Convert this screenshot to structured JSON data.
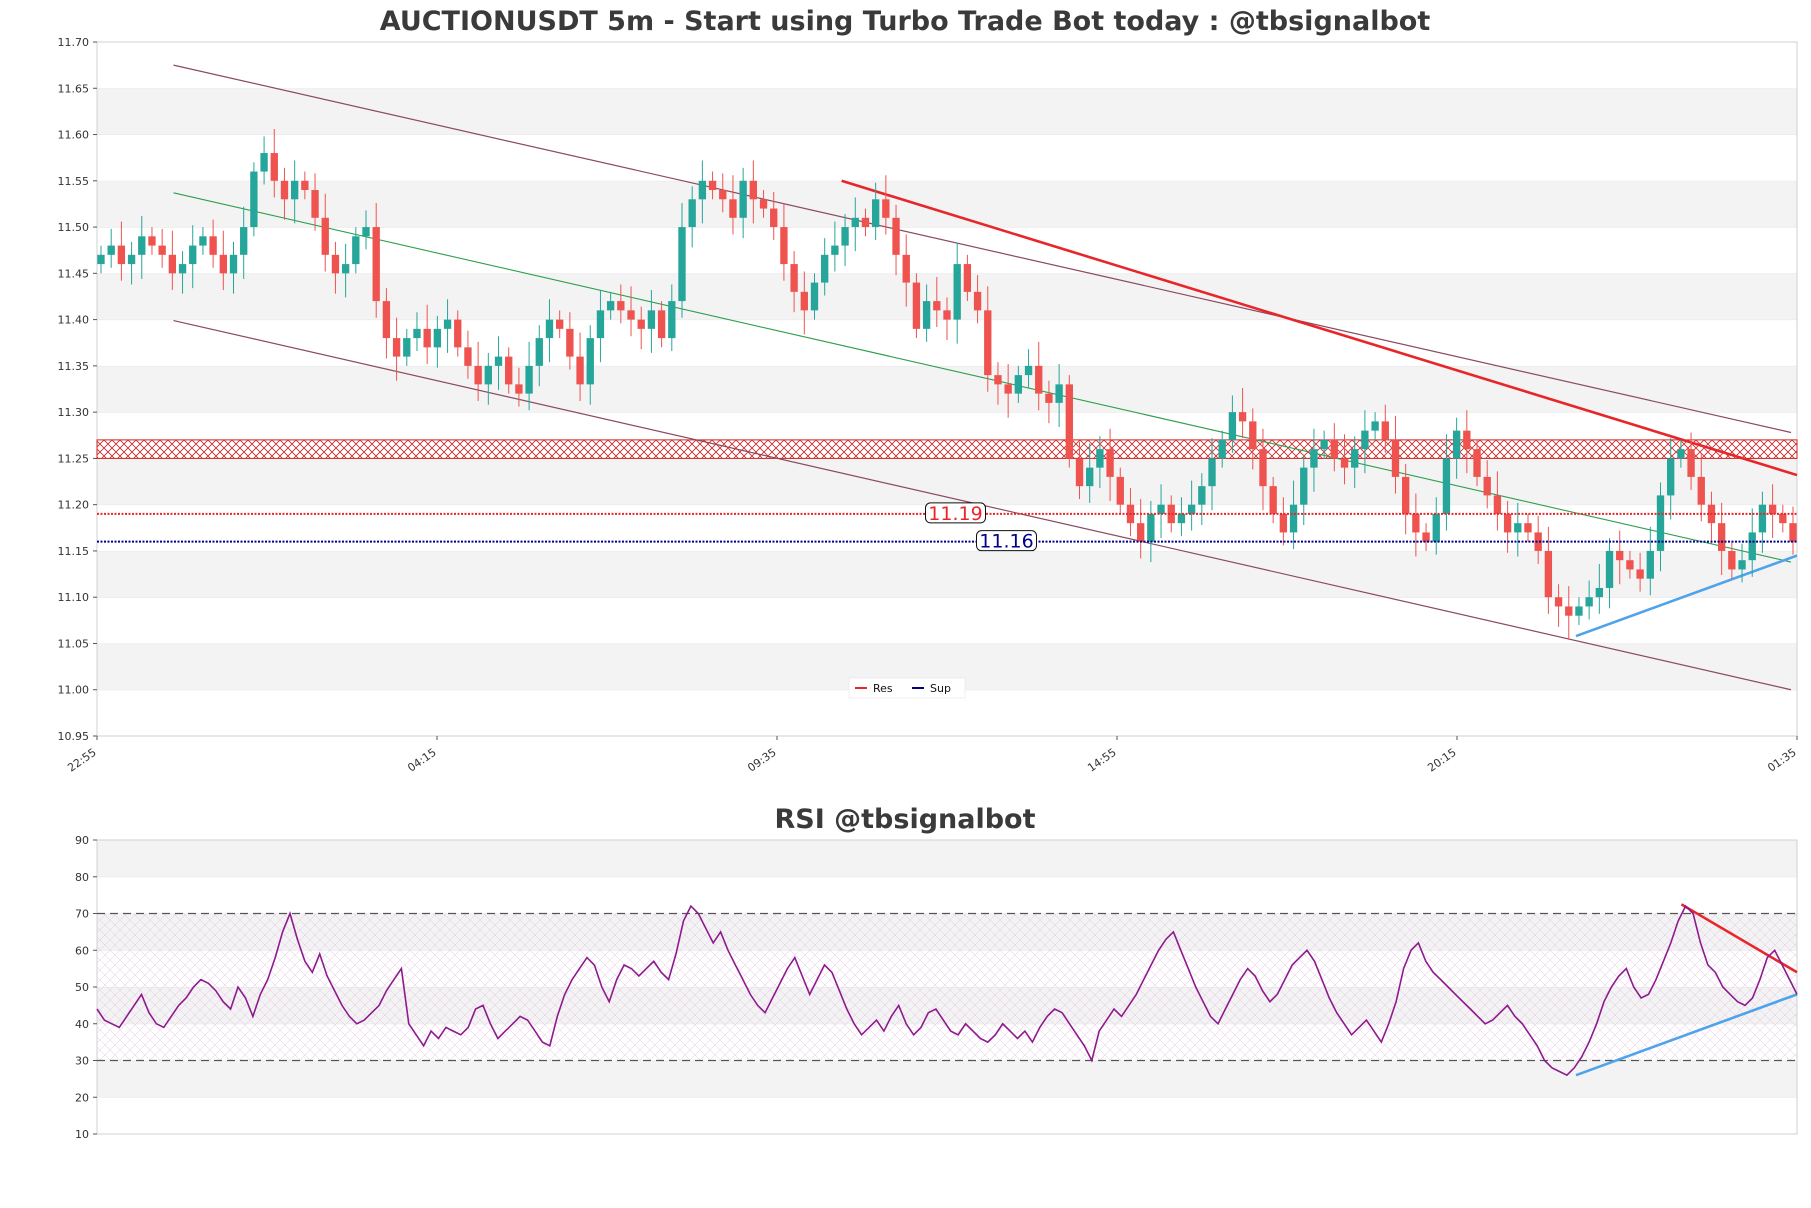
{
  "chart_data": [
    {
      "type": "candlestick",
      "title": "AUCTIONUSDT 5m - Start using Turbo Trade Bot today : @tbsignalbot",
      "ylim": [
        10.95,
        11.7
      ],
      "y_ticks": [
        "10.95",
        "11.00",
        "11.05",
        "11.10",
        "11.15",
        "11.20",
        "11.25",
        "11.30",
        "11.35",
        "11.40",
        "11.45",
        "11.50",
        "11.55",
        "11.60",
        "11.65",
        "11.70"
      ],
      "x_ticks": [
        "22:55",
        "04:15",
        "09:35",
        "14:55",
        "20:15",
        "01:35"
      ],
      "colors": {
        "up": "#26a69a",
        "down": "#ef5350",
        "resistance": "#e8262a",
        "support": "#00008b",
        "channel": "#8b4a5e",
        "midline": "#2e9e4e",
        "trend_up": "#4ea3ea",
        "zone": "#cc2222"
      },
      "legend": [
        {
          "label": "Res",
          "color": "#e8262a"
        },
        {
          "label": "Sup",
          "color": "#00008b"
        }
      ],
      "levels": [
        {
          "name": "Res",
          "value": 11.19,
          "label": "11.19"
        },
        {
          "name": "Sup",
          "value": 11.16,
          "label": "11.16"
        }
      ],
      "resistance_zone": [
        11.25,
        11.27
      ],
      "close_series": [
        11.47,
        11.48,
        11.46,
        11.47,
        11.49,
        11.48,
        11.47,
        11.45,
        11.46,
        11.48,
        11.49,
        11.47,
        11.45,
        11.47,
        11.5,
        11.56,
        11.58,
        11.55,
        11.53,
        11.55,
        11.54,
        11.51,
        11.47,
        11.45,
        11.46,
        11.49,
        11.5,
        11.42,
        11.38,
        11.36,
        11.38,
        11.39,
        11.37,
        11.39,
        11.4,
        11.37,
        11.35,
        11.33,
        11.35,
        11.36,
        11.33,
        11.32,
        11.35,
        11.38,
        11.4,
        11.39,
        11.36,
        11.33,
        11.38,
        11.41,
        11.42,
        11.41,
        11.4,
        11.39,
        11.41,
        11.38,
        11.42,
        11.5,
        11.53,
        11.55,
        11.54,
        11.53,
        11.51,
        11.55,
        11.53,
        11.52,
        11.5,
        11.46,
        11.43,
        11.41,
        11.44,
        11.47,
        11.48,
        11.5,
        11.51,
        11.5,
        11.53,
        11.51,
        11.47,
        11.44,
        11.39,
        11.42,
        11.41,
        11.4,
        11.46,
        11.43,
        11.41,
        11.34,
        11.33,
        11.32,
        11.34,
        11.35,
        11.32,
        11.31,
        11.33,
        11.25,
        11.22,
        11.24,
        11.26,
        11.23,
        11.2,
        11.18,
        11.16,
        11.19,
        11.2,
        11.18,
        11.19,
        11.2,
        11.22,
        11.25,
        11.27,
        11.3,
        11.29,
        11.26,
        11.22,
        11.19,
        11.17,
        11.2,
        11.24,
        11.26,
        11.27,
        11.25,
        11.24,
        11.26,
        11.28,
        11.29,
        11.27,
        11.23,
        11.19,
        11.17,
        11.16,
        11.19,
        11.25,
        11.28,
        11.26,
        11.23,
        11.21,
        11.19,
        11.17,
        11.18,
        11.17,
        11.15,
        11.1,
        11.09,
        11.08,
        11.09,
        11.1,
        11.11,
        11.15,
        11.14,
        11.13,
        11.12,
        11.15,
        11.21,
        11.25,
        11.26,
        11.23,
        11.2,
        11.18,
        11.15,
        11.13,
        11.14,
        11.17,
        11.2,
        11.19,
        11.18,
        11.16
      ],
      "overlay_lines": [
        {
          "name": "channel-upper",
          "points": [
            [
              "22:55+",
              11.675
            ],
            [
              "01:35",
              11.278
            ]
          ]
        },
        {
          "name": "channel-mid",
          "points": [
            [
              "22:55+",
              11.537
            ],
            [
              "01:35",
              11.138
            ]
          ]
        },
        {
          "name": "channel-lower",
          "points": [
            [
              "22:55+",
              11.399
            ],
            [
              "01:35",
              11.0
            ]
          ]
        },
        {
          "name": "trend-resistance",
          "points": [
            [
              0.438,
              11.55
            ],
            [
              1.0,
              11.232
            ]
          ]
        },
        {
          "name": "trend-support",
          "points": [
            [
              0.87,
              11.058
            ],
            [
              1.0,
              11.145
            ]
          ]
        }
      ]
    },
    {
      "type": "line",
      "title": "RSI @tbsignalbot",
      "ylim": [
        10,
        90
      ],
      "y_ticks": [
        "10",
        "20",
        "30",
        "40",
        "50",
        "60",
        "70",
        "80",
        "90"
      ],
      "reference_lines": [
        30,
        70
      ],
      "colors": {
        "rsi": "#8e1a8e",
        "trend_down": "#e8262a",
        "trend_up": "#4ea3ea"
      },
      "values": [
        44,
        41,
        40,
        39,
        42,
        45,
        48,
        43,
        40,
        39,
        42,
        45,
        47,
        50,
        52,
        51,
        49,
        46,
        44,
        50,
        47,
        42,
        48,
        52,
        58,
        65,
        70,
        63,
        57,
        54,
        59,
        53,
        49,
        45,
        42,
        40,
        41,
        43,
        45,
        49,
        52,
        55,
        40,
        37,
        34,
        38,
        36,
        39,
        38,
        37,
        39,
        44,
        45,
        40,
        36,
        38,
        40,
        42,
        41,
        38,
        35,
        34,
        42,
        48,
        52,
        55,
        58,
        56,
        50,
        46,
        52,
        56,
        55,
        53,
        55,
        57,
        54,
        52,
        59,
        68,
        72,
        70,
        66,
        62,
        65,
        60,
        56,
        52,
        48,
        45,
        43,
        47,
        51,
        55,
        58,
        53,
        48,
        52,
        56,
        54,
        49,
        44,
        40,
        37,
        39,
        41,
        38,
        42,
        45,
        40,
        37,
        39,
        43,
        44,
        41,
        38,
        37,
        40,
        38,
        36,
        35,
        37,
        40,
        38,
        36,
        38,
        35,
        39,
        42,
        44,
        43,
        40,
        37,
        34,
        30,
        38,
        41,
        44,
        42,
        45,
        48,
        52,
        56,
        60,
        63,
        65,
        60,
        55,
        50,
        46,
        42,
        40,
        44,
        48,
        52,
        55,
        53,
        49,
        46,
        48,
        52,
        56,
        58,
        60,
        57,
        52,
        47,
        43,
        40,
        37,
        39,
        41,
        38,
        35,
        40,
        46,
        55,
        60,
        62,
        57,
        54,
        52,
        50,
        48,
        46,
        44,
        42,
        40,
        41,
        43,
        45,
        42,
        40,
        37,
        34,
        30,
        28,
        27,
        26,
        28,
        31,
        35,
        40,
        46,
        50,
        53,
        55,
        50,
        47,
        48,
        52,
        57,
        62,
        68,
        72,
        70,
        62,
        56,
        54,
        50,
        48,
        46,
        45,
        47,
        52,
        58,
        60,
        56,
        52,
        48
      ]
    }
  ]
}
